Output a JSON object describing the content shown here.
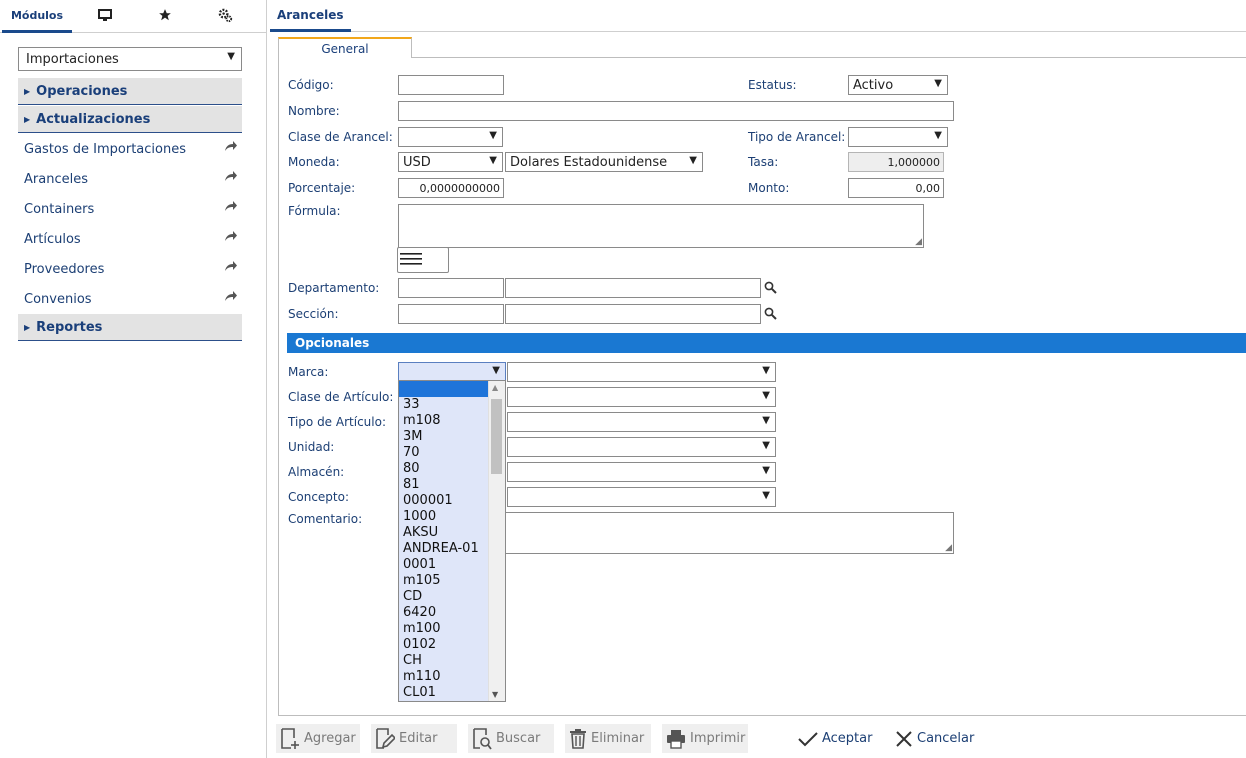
{
  "sidebar": {
    "tabs": [
      {
        "label": "Módulos",
        "icon": "",
        "active": true
      },
      {
        "label": "",
        "icon": "monitor-icon"
      },
      {
        "label": "",
        "icon": "star-icon"
      },
      {
        "label": "",
        "icon": "gear-icon"
      }
    ],
    "module_select": "Importaciones",
    "groups": {
      "operaciones": "Operaciones",
      "actualizaciones": "Actualizaciones",
      "reportes": "Reportes"
    },
    "items": [
      "Gastos de Importaciones",
      "Aranceles",
      "Containers",
      "Artículos",
      "Proveedores",
      "Convenios"
    ]
  },
  "main": {
    "tab": "Aranceles",
    "form_tab": "General",
    "fields": {
      "codigo": {
        "label": "Código:",
        "value": ""
      },
      "estatus": {
        "label": "Estatus:",
        "value": "Activo"
      },
      "nombre": {
        "label": "Nombre:",
        "value": ""
      },
      "clase_arancel": {
        "label": "Clase de Arancel:",
        "value": ""
      },
      "tipo_arancel": {
        "label": "Tipo de Arancel:",
        "value": ""
      },
      "moneda": {
        "label": "Moneda:",
        "code": "USD",
        "name": "Dolares Estadounidense"
      },
      "tasa": {
        "label": "Tasa:",
        "value": "1,000000"
      },
      "porcentaje": {
        "label": "Porcentaje:",
        "value": "0,0000000000"
      },
      "monto": {
        "label": "Monto:",
        "value": "0,00"
      },
      "formula": {
        "label": "Fórmula:",
        "value": ""
      },
      "departamento": {
        "label": "Departamento:"
      },
      "seccion": {
        "label": "Sección:"
      }
    },
    "opcionales": {
      "title": "Opcionales",
      "marca": "Marca:",
      "clase_articulo": "Clase de Artículo:",
      "tipo_articulo": "Tipo de Artículo:",
      "unidad": "Unidad:",
      "almacen": "Almacén:",
      "concepto": "Concepto:",
      "comentario": "Comentario:"
    },
    "marca_options": [
      "",
      "33",
      "m108",
      "3M",
      "70",
      "80",
      "81",
      "000001",
      "1000",
      "AKSU",
      "ANDREA-01",
      "0001",
      "m105",
      "CD",
      "6420",
      "m100",
      "0102",
      "CH",
      "m110",
      "CL01"
    ]
  },
  "toolbar": {
    "agregar": "Agregar",
    "editar": "Editar",
    "buscar": "Buscar",
    "eliminar": "Eliminar",
    "imprimir": "Imprimir",
    "aceptar": "Aceptar",
    "cancelar": "Cancelar"
  },
  "colors": {
    "accent": "#1a78d2",
    "nav_text": "#1c3f74",
    "tab_highlight": "#f2a71b",
    "list_bg": "#dfe6f9",
    "list_selected": "#1e74d9"
  }
}
